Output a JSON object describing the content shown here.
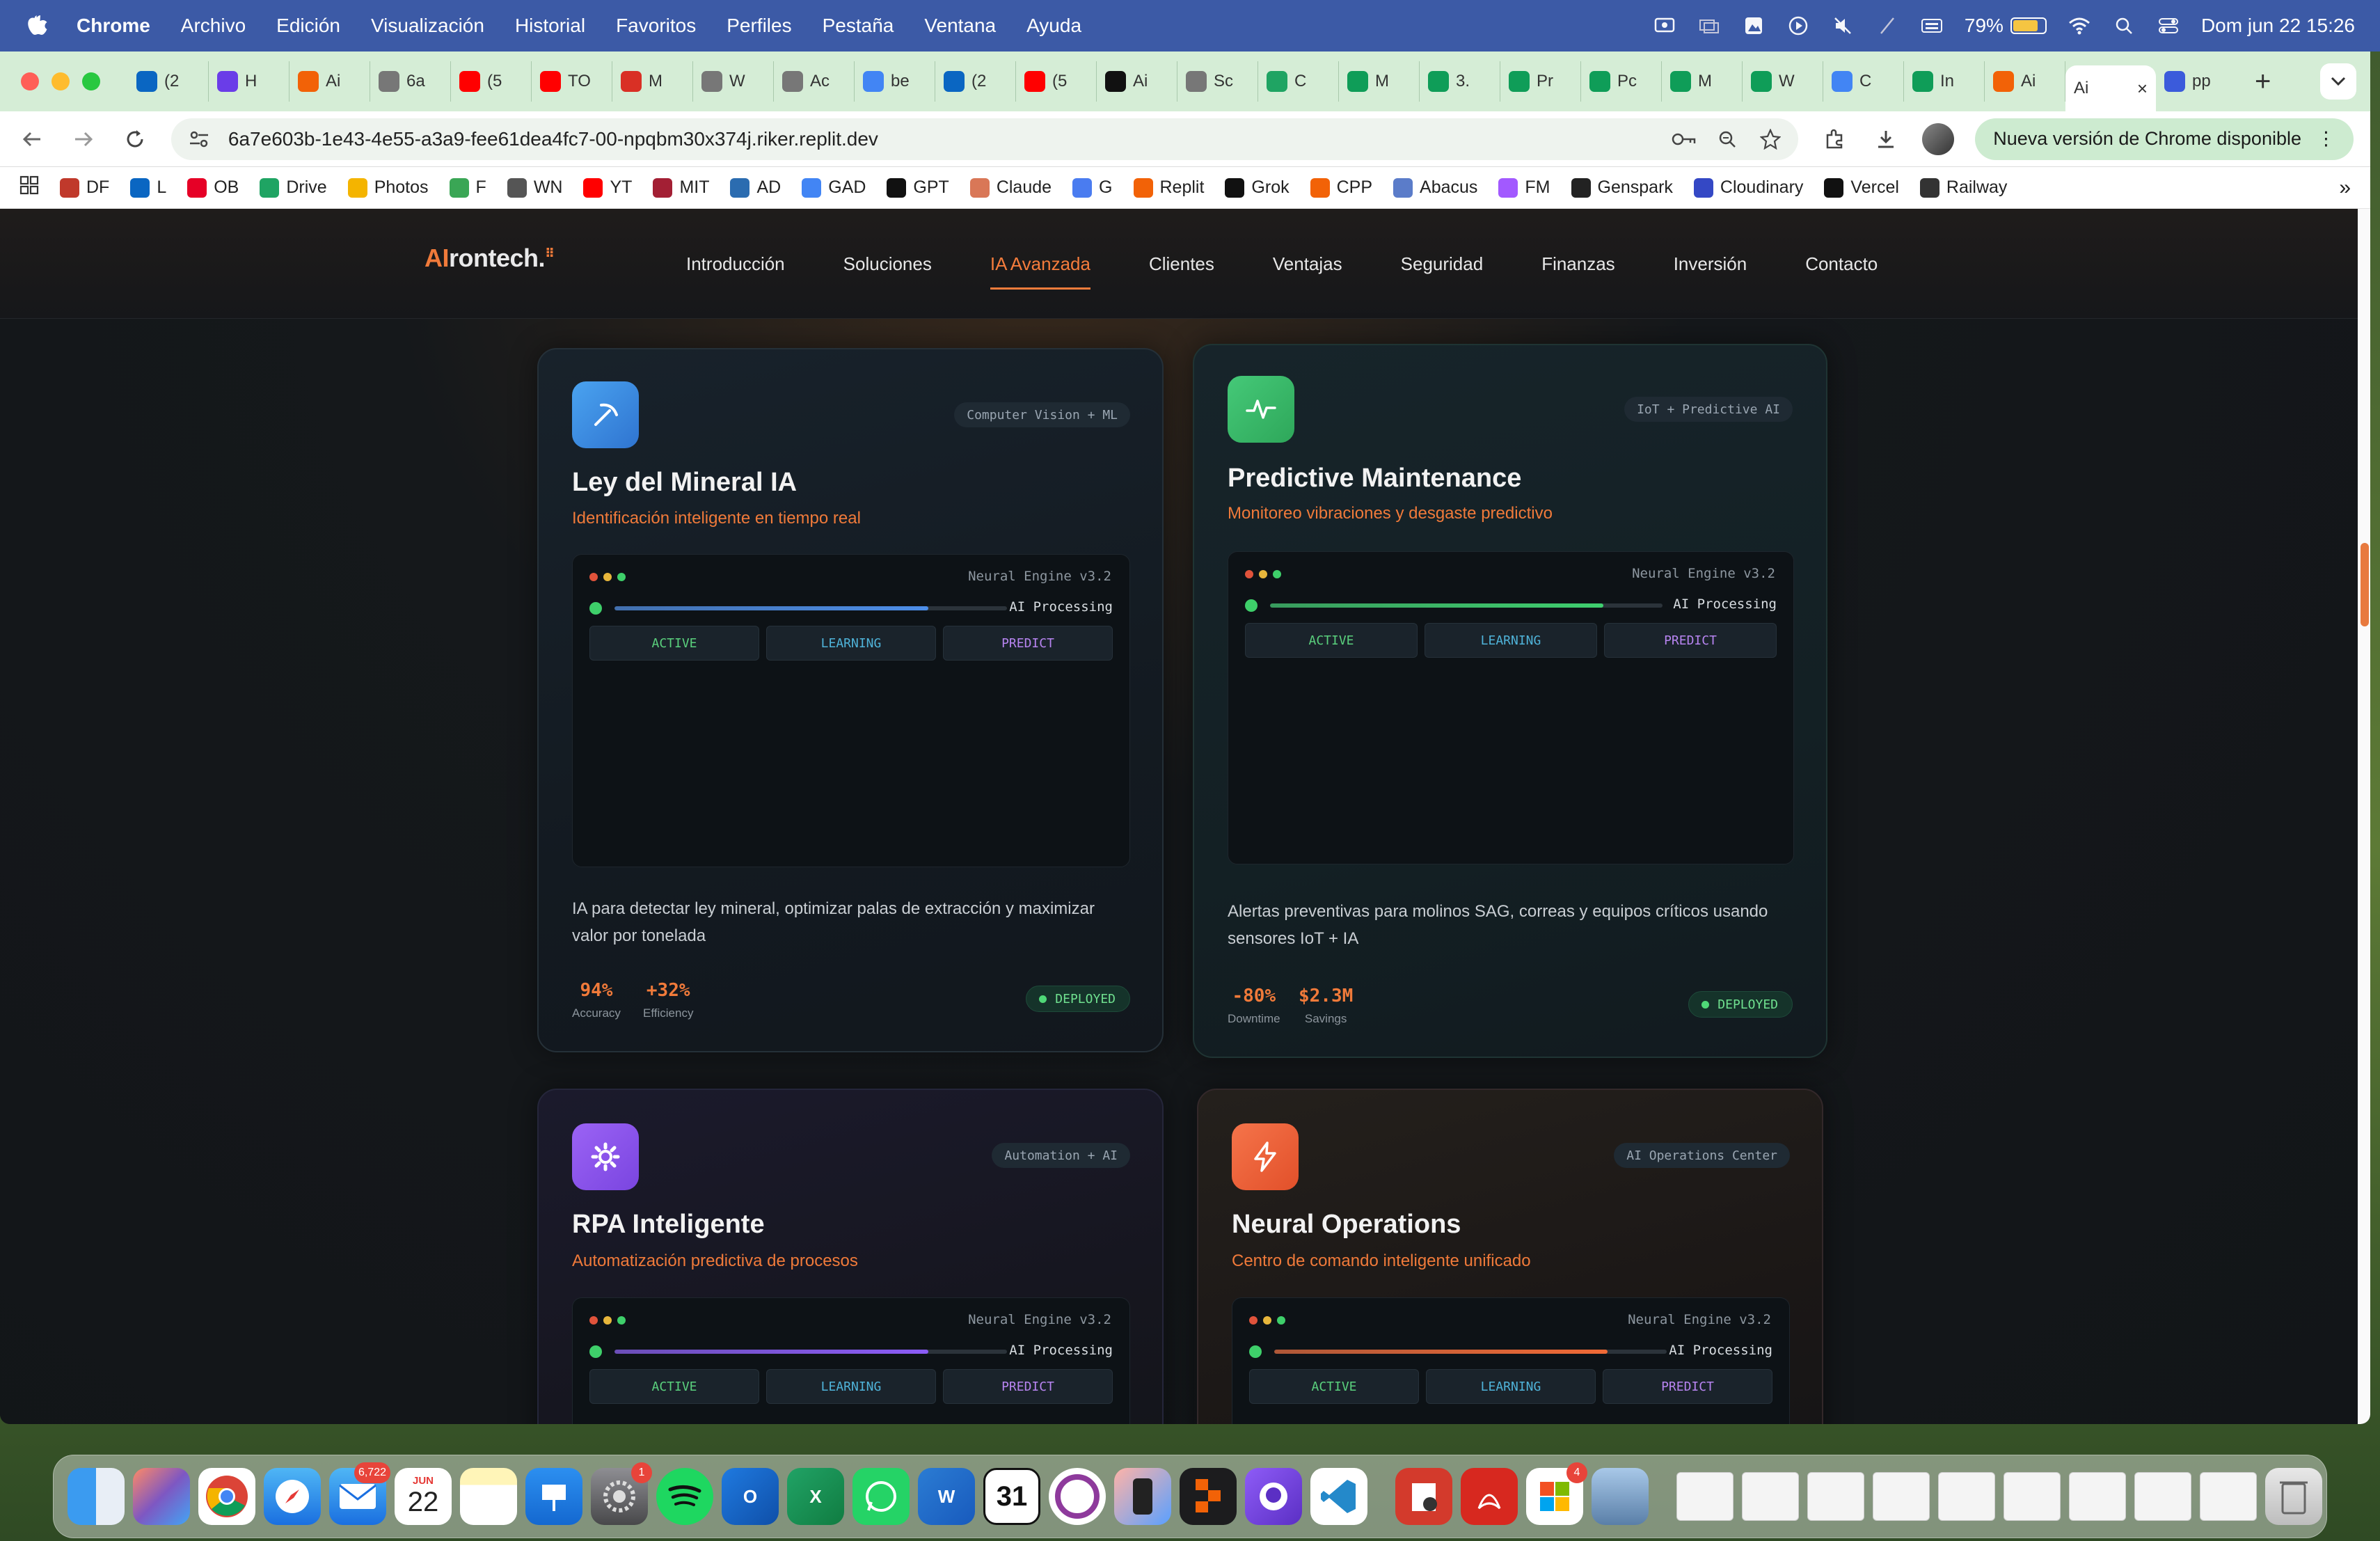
{
  "menubar": {
    "app_name": "Chrome",
    "items": [
      "Archivo",
      "Edición",
      "Visualización",
      "Historial",
      "Favoritos",
      "Perfiles",
      "Pestaña",
      "Ventana",
      "Ayuda"
    ],
    "battery_percent": "79%",
    "battery_level": 0.79,
    "datetime": "Dom jun 22  15:26"
  },
  "tabs": [
    {
      "label": "(2",
      "icon": "linkedin-icon",
      "color": "#0a66c2"
    },
    {
      "label": "H",
      "icon": "circle-play-icon",
      "color": "#6a3de8"
    },
    {
      "label": "Ai",
      "icon": "replit-icon",
      "color": "#f26207"
    },
    {
      "label": "6a",
      "icon": "globe-icon",
      "color": "#777777"
    },
    {
      "label": "(5",
      "icon": "youtube-icon",
      "color": "#ff0000"
    },
    {
      "label": "TO",
      "icon": "youtube-icon",
      "color": "#ff0000"
    },
    {
      "label": "M",
      "icon": "red-circle-icon",
      "color": "#d93025"
    },
    {
      "label": "W",
      "icon": "globe-icon",
      "color": "#777777"
    },
    {
      "label": "Ac",
      "icon": "globe-icon",
      "color": "#777777"
    },
    {
      "label": "be",
      "icon": "google-icon",
      "color": "#4285f4"
    },
    {
      "label": "(2",
      "icon": "linkedin-icon",
      "color": "#0a66c2"
    },
    {
      "label": "(5",
      "icon": "youtube-icon",
      "color": "#ff0000"
    },
    {
      "label": "Ai",
      "icon": "openai-icon",
      "color": "#111111"
    },
    {
      "label": "Sc",
      "icon": "globe-icon",
      "color": "#777777"
    },
    {
      "label": "C",
      "icon": "drive-icon",
      "color": "#1fa463"
    },
    {
      "label": "M",
      "icon": "sheets-icon",
      "color": "#0f9d58"
    },
    {
      "label": "3.",
      "icon": "sheets-icon",
      "color": "#0f9d58"
    },
    {
      "label": "Pr",
      "icon": "sheets-icon",
      "color": "#0f9d58"
    },
    {
      "label": "Pc",
      "icon": "sheets-icon",
      "color": "#0f9d58"
    },
    {
      "label": "M",
      "icon": "sheets-icon",
      "color": "#0f9d58"
    },
    {
      "label": "W",
      "icon": "sheets-icon",
      "color": "#0f9d58"
    },
    {
      "label": "C",
      "icon": "docs-icon",
      "color": "#4285f4"
    },
    {
      "label": "In",
      "icon": "sheets-icon",
      "color": "#0f9d58"
    },
    {
      "label": "Ai",
      "icon": "replit-icon",
      "color": "#f26207"
    }
  ],
  "active_tab": {
    "label": "Ai"
  },
  "last_tab": {
    "label": "pp",
    "icon": "globe-icon",
    "color": "#3b5bdb"
  },
  "address_bar": {
    "url": "6a7e603b-1e43-4e55-a3a9-fee61dea4fc7-00-npqbm30x374j.riker.replit.dev",
    "update_label": "Nueva versión de Chrome disponible"
  },
  "bookmarks": [
    {
      "label": "DF",
      "color": "#c0392b"
    },
    {
      "label": "L",
      "color": "#0a66c2"
    },
    {
      "label": "OB",
      "color": "#e60026"
    },
    {
      "label": "Drive",
      "color": "#1fa463"
    },
    {
      "label": "Photos",
      "color": "#f4b400"
    },
    {
      "label": "F",
      "color": "#3aa655"
    },
    {
      "label": "WN",
      "color": "#555555"
    },
    {
      "label": "YT",
      "color": "#ff0000"
    },
    {
      "label": "MIT",
      "color": "#a31f34"
    },
    {
      "label": "AD",
      "color": "#2b6cb0"
    },
    {
      "label": "GAD",
      "color": "#4285f4"
    },
    {
      "label": "GPT",
      "color": "#111111"
    },
    {
      "label": "Claude",
      "color": "#d97757"
    },
    {
      "label": "G",
      "color": "#4a7cf0"
    },
    {
      "label": "Replit",
      "color": "#f26207"
    },
    {
      "label": "Grok",
      "color": "#111111"
    },
    {
      "label": "CPP",
      "color": "#f26207"
    },
    {
      "label": "Abacus",
      "color": "#5b7cc9"
    },
    {
      "label": "FM",
      "color": "#a259ff"
    },
    {
      "label": "Genspark",
      "color": "#222222"
    },
    {
      "label": "Cloudinary",
      "color": "#3448c5"
    },
    {
      "label": "Vercel",
      "color": "#111111"
    },
    {
      "label": "Railway",
      "color": "#333333"
    }
  ],
  "site": {
    "logo_ai": "AI",
    "logo_rest": "rontech.",
    "nav": [
      "Introducción",
      "Soluciones",
      "IA Avanzada",
      "Clientes",
      "Ventajas",
      "Seguridad",
      "Finanzas",
      "Inversión",
      "Contacto"
    ],
    "active_nav": "IA Avanzada"
  },
  "engine_common": {
    "label": "Neural Engine v3.2",
    "processing": "AI Processing",
    "buttons": [
      "ACTIVE",
      "LEARNING",
      "PREDICT"
    ]
  },
  "cards": [
    {
      "title": "Ley del Mineral IA",
      "subtitle": "Identificación inteligente en tiempo real",
      "tag": "Computer Vision + ML",
      "icon": "pickaxe-icon",
      "icon_color": "#3b8fe0",
      "bar_color": "#4d8ee8",
      "progress": 0.8,
      "description": "IA para detectar ley mineral, optimizar palas de extracción y maximizar valor por tonelada",
      "metrics": [
        {
          "value": "94%",
          "label": "Accuracy"
        },
        {
          "value": "+32%",
          "label": "Efficiency"
        }
      ],
      "status": "DEPLOYED"
    },
    {
      "title": "Predictive Maintenance",
      "subtitle": "Monitoreo vibraciones y desgaste predictivo",
      "tag": "IoT + Predictive AI",
      "icon": "activity-icon",
      "icon_color": "#3fbf6b",
      "bar_color": "#3fcf6f",
      "progress": 0.85,
      "description": "Alertas preventivas para molinos SAG, correas y equipos críticos usando sensores IoT + IA",
      "metrics": [
        {
          "value": "-80%",
          "label": "Downtime"
        },
        {
          "value": "$2.3M",
          "label": "Savings"
        }
      ],
      "status": "DEPLOYED"
    },
    {
      "title": "RPA Inteligente",
      "subtitle": "Automatización predictiva de procesos",
      "tag": "Automation + AI",
      "icon": "gear-icon",
      "icon_color": "#8b55f0",
      "bar_color": "#8b5cf6",
      "progress": 0.8
    },
    {
      "title": "Neural Operations",
      "subtitle": "Centro de comando inteligente unificado",
      "tag": "AI Operations Center",
      "icon": "lightning-icon",
      "icon_color": "#f0602e",
      "bar_color": "#f06a36",
      "progress": 0.85
    }
  ],
  "dock": {
    "mail_badge": "6,722",
    "calendar_month": "JUN",
    "calendar_day": "22",
    "settings_badge": "1",
    "office_badge": "4",
    "ical_day": "31"
  }
}
